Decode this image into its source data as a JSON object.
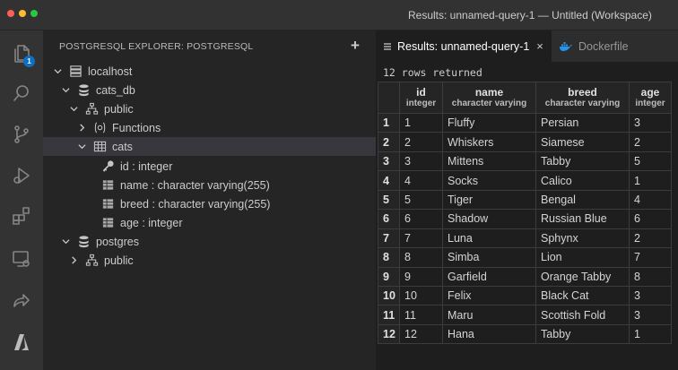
{
  "window": {
    "title": "Results: unnamed-query-1 — Untitled (Workspace)",
    "traffic_colors": [
      "#ff5f57",
      "#febc2e",
      "#28c840"
    ]
  },
  "activity_bar": {
    "items": [
      {
        "name": "explorer-icon",
        "badge": "1"
      },
      {
        "name": "search-icon"
      },
      {
        "name": "source-control-icon"
      },
      {
        "name": "run-debug-icon"
      },
      {
        "name": "extensions-icon"
      },
      {
        "name": "remote-explorer-icon"
      },
      {
        "name": "live-share-icon"
      },
      {
        "name": "azure-icon"
      }
    ]
  },
  "sidebar": {
    "header": "POSTGRESQL EXPLORER: POSTGRESQL",
    "add_label": "+",
    "tree": [
      {
        "label": "localhost",
        "depth": 0,
        "chevron": "down",
        "icon": "server-icon"
      },
      {
        "label": "cats_db",
        "depth": 1,
        "chevron": "down",
        "icon": "database-icon"
      },
      {
        "label": "public",
        "depth": 2,
        "chevron": "down",
        "icon": "schema-icon"
      },
      {
        "label": "Functions",
        "depth": 3,
        "chevron": "right",
        "icon": "function-icon"
      },
      {
        "label": "cats",
        "depth": 3,
        "chevron": "down",
        "icon": "table-icon",
        "selected": true
      },
      {
        "label": "id : integer",
        "depth": 4,
        "icon": "key-icon"
      },
      {
        "label": "name : character varying(255)",
        "depth": 4,
        "icon": "column-icon"
      },
      {
        "label": "breed : character varying(255)",
        "depth": 4,
        "icon": "column-icon"
      },
      {
        "label": "age : integer",
        "depth": 4,
        "icon": "column-icon"
      },
      {
        "label": "postgres",
        "depth": 1,
        "chevron": "down",
        "icon": "database-icon"
      },
      {
        "label": "public",
        "depth": 2,
        "chevron": "right",
        "icon": "schema-icon"
      }
    ]
  },
  "editor": {
    "tabs": [
      {
        "label": "Results: unnamed-query-1",
        "active": true,
        "close": "×",
        "icon": "results-icon"
      },
      {
        "label": "Dockerfile",
        "active": false,
        "icon": "docker-icon"
      }
    ],
    "rows_returned": "12 rows returned",
    "columns": [
      {
        "name": "id",
        "type": "integer"
      },
      {
        "name": "name",
        "type": "character varying"
      },
      {
        "name": "breed",
        "type": "character varying"
      },
      {
        "name": "age",
        "type": "integer"
      }
    ],
    "rows": [
      {
        "n": "1",
        "cells": [
          "1",
          "Fluffy",
          "Persian",
          "3"
        ]
      },
      {
        "n": "2",
        "cells": [
          "2",
          "Whiskers",
          "Siamese",
          "2"
        ]
      },
      {
        "n": "3",
        "cells": [
          "3",
          "Mittens",
          "Tabby",
          "5"
        ]
      },
      {
        "n": "4",
        "cells": [
          "4",
          "Socks",
          "Calico",
          "1"
        ]
      },
      {
        "n": "5",
        "cells": [
          "5",
          "Tiger",
          "Bengal",
          "4"
        ]
      },
      {
        "n": "6",
        "cells": [
          "6",
          "Shadow",
          "Russian Blue",
          "6"
        ]
      },
      {
        "n": "7",
        "cells": [
          "7",
          "Luna",
          "Sphynx",
          "2"
        ]
      },
      {
        "n": "8",
        "cells": [
          "8",
          "Simba",
          "Lion",
          "7"
        ]
      },
      {
        "n": "9",
        "cells": [
          "9",
          "Garfield",
          "Orange Tabby",
          "8"
        ]
      },
      {
        "n": "10",
        "cells": [
          "10",
          "Felix",
          "Black Cat",
          "3"
        ]
      },
      {
        "n": "11",
        "cells": [
          "11",
          "Maru",
          "Scottish Fold",
          "3"
        ]
      },
      {
        "n": "12",
        "cells": [
          "12",
          "Hana",
          "Tabby",
          "1"
        ]
      }
    ]
  },
  "colors": {
    "accent": "#0e70c0",
    "docker": "#2496ed"
  }
}
